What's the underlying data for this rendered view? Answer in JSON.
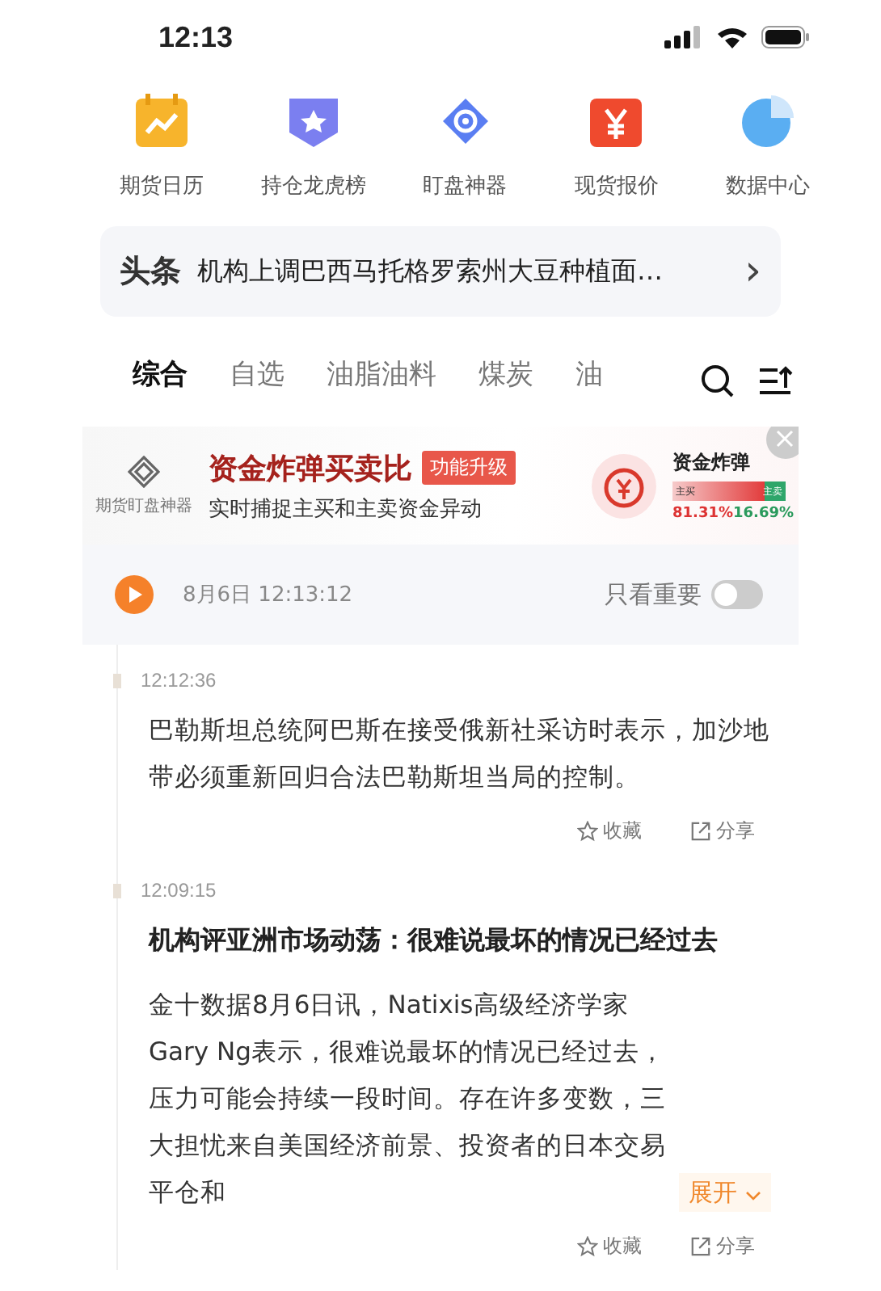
{
  "status_bar": {
    "time": "12:13"
  },
  "shortcuts": [
    {
      "label": "期货日历",
      "kind": "calendar"
    },
    {
      "label": "持仓龙虎榜",
      "kind": "badge"
    },
    {
      "label": "盯盘神器",
      "kind": "target"
    },
    {
      "label": "现货报价",
      "kind": "yen"
    },
    {
      "label": "数据中心",
      "kind": "pie"
    }
  ],
  "headline": {
    "logo": "头条",
    "text": "机构上调巴西马托格罗索州大豆种植面…",
    "arrow": "›"
  },
  "tabs": [
    {
      "label": "综合",
      "selected": true
    },
    {
      "label": "自选",
      "selected": false
    },
    {
      "label": "油脂油料",
      "selected": false
    },
    {
      "label": "煤炭",
      "selected": false
    },
    {
      "label": "油",
      "selected": false
    }
  ],
  "ad": {
    "brand": "期货盯盘神器",
    "title": "资金炸弹买卖比",
    "tag": "功能升级",
    "subtitle": "实时捕捉主买和主卖资金异动",
    "widget_title": "资金炸弹",
    "buy_label": "主买",
    "sell_label": "主卖",
    "buy_pct": "81.31%",
    "sell_pct": "16.69%",
    "level": 0.81
  },
  "timeline_bar": {
    "date": "8月6日 12:13:12",
    "filter_label": "只看重要",
    "filter_on": false
  },
  "news": [
    {
      "time": "12:12:36",
      "body": "巴勒斯坦总统阿巴斯在接受俄新社采访时表示，加沙地带必须重新回归合法巴勒斯坦当局的控制。",
      "actions": [
        "收藏",
        "分享"
      ]
    },
    {
      "time": "12:09:15",
      "title": "机构评亚洲市场动荡：很难说最坏的情况已经过去",
      "body": "金十数据8月6日讯，Natixis高级经济学家Gary Ng表示，很难说最坏的情况已经过去，压力可能会持续一段时间。存在许多变数，三大担忧来自美国经济前景、投资者的日本交易平仓和",
      "expand": "展开",
      "actions": [
        "收藏",
        "分享"
      ]
    }
  ]
}
